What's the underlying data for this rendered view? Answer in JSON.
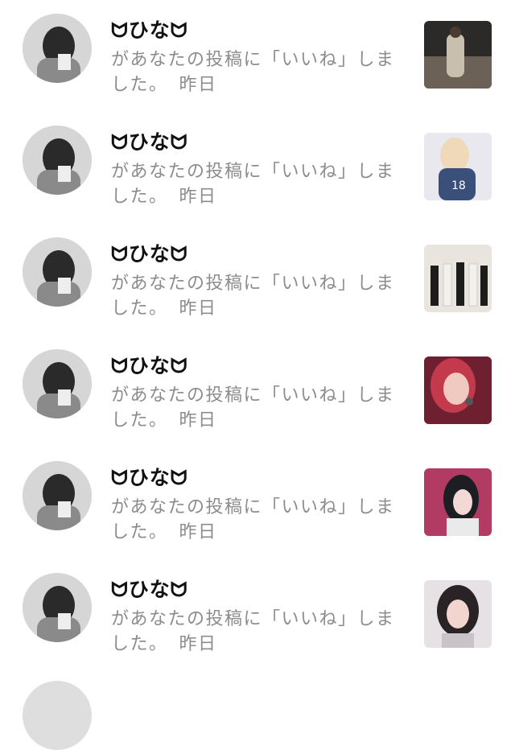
{
  "notifications": [
    {
      "username": "ᗢひなᗢ",
      "message": "があなたの投稿に「いいね」しました。",
      "time": "昨日",
      "thumb_colors": [
        "#2b2a28",
        "#6b6156",
        "#c9bfae"
      ]
    },
    {
      "username": "ᗢひなᗢ",
      "message": "があなたの投稿に「いいね」しました。",
      "time": "昨日",
      "thumb_colors": [
        "#3a4f7a",
        "#efd9b8",
        "#e8e8ee"
      ]
    },
    {
      "username": "ᗢひなᗢ",
      "message": "があなたの投稿に「いいね」しました。",
      "time": "昨日",
      "thumb_colors": [
        "#e9e4dd",
        "#1c1c1c",
        "#f4f1ec"
      ]
    },
    {
      "username": "ᗢひなᗢ",
      "message": "があなたの投稿に「いいね」しました。",
      "time": "昨日",
      "thumb_colors": [
        "#c43a4d",
        "#f0c9c0",
        "#6f2030"
      ]
    },
    {
      "username": "ᗢひなᗢ",
      "message": "があなたの投稿に「いいね」しました。",
      "time": "昨日",
      "thumb_colors": [
        "#b23b63",
        "#1d1d24",
        "#f2d9d6"
      ]
    },
    {
      "username": "ᗢひなᗢ",
      "message": "があなたの投稿に「いいね」しました。",
      "time": "昨日",
      "thumb_colors": [
        "#e6e1e4",
        "#2a2326",
        "#f3d5cf"
      ]
    }
  ]
}
